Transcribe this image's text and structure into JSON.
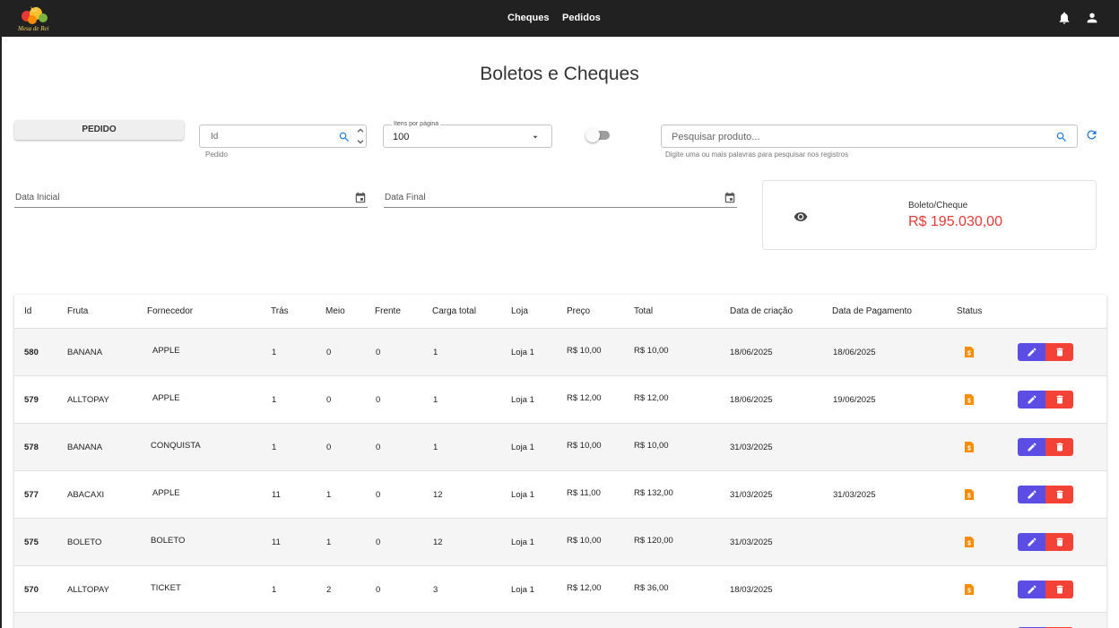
{
  "header": {
    "logo_text": "Mesa de Rei",
    "nav": [
      "Cheques",
      "Pedidos"
    ]
  },
  "page": {
    "title": "Boletos e Cheques"
  },
  "filters": {
    "pedido_button": "PEDIDO",
    "id_placeholder": "Id",
    "id_helper": "Pedido",
    "items_label": "Itens por página",
    "items_value": "100",
    "search_placeholder": "Pesquisar produto...",
    "search_helper": "Digite uma ou mais palavras para pesquisar nos registros",
    "date_start": "Data Inicial",
    "date_end": "Data Final"
  },
  "summary": {
    "label": "Boleto/Cheque",
    "value": "R$ 195.030,00"
  },
  "table": {
    "headers": [
      "Id",
      "Fruta",
      "Fornecedor",
      "Trás",
      "Meio",
      "Frente",
      "Carga total",
      "Loja",
      "Preço",
      "Total",
      "Data de criação",
      "Data de Pagamento",
      "Status"
    ],
    "rows": [
      {
        "id": "580",
        "fruta": "BANANA",
        "fornecedor": "APPLE",
        "tras": "1",
        "meio": "0",
        "frente": "0",
        "carga": "1",
        "loja": "Loja 1",
        "preco": "R$ 10,00",
        "total": "R$ 10,00",
        "criacao": "18/06/2025",
        "pagamento": "18/06/2025"
      },
      {
        "id": "579",
        "fruta": "ALLTOPAY",
        "fornecedor": "APPLE",
        "tras": "1",
        "meio": "0",
        "frente": "0",
        "carga": "1",
        "loja": "Loja 1",
        "preco": "R$ 12,00",
        "total": "R$ 12,00",
        "criacao": "18/06/2025",
        "pagamento": "19/06/2025"
      },
      {
        "id": "578",
        "fruta": "BANANA",
        "fornecedor": "CONQUISTA",
        "tras": "1",
        "meio": "0",
        "frente": "0",
        "carga": "1",
        "loja": "Loja 1",
        "preco": "R$ 10,00",
        "total": "R$ 10,00",
        "criacao": "31/03/2025",
        "pagamento": ""
      },
      {
        "id": "577",
        "fruta": "ABACAXI",
        "fornecedor": "APPLE",
        "tras": "11",
        "meio": "1",
        "frente": "0",
        "carga": "12",
        "loja": "Loja 1",
        "preco": "R$ 11,00",
        "total": "R$ 132,00",
        "criacao": "31/03/2025",
        "pagamento": "31/03/2025"
      },
      {
        "id": "575",
        "fruta": "BOLETO",
        "fornecedor": "BOLETO",
        "tras": "11",
        "meio": "1",
        "frente": "0",
        "carga": "12",
        "loja": "Loja 1",
        "preco": "R$ 10,00",
        "total": "R$ 120,00",
        "criacao": "31/03/2025",
        "pagamento": ""
      },
      {
        "id": "570",
        "fruta": "ALLTOPAY",
        "fornecedor": "TICKET",
        "tras": "1",
        "meio": "2",
        "frente": "0",
        "carga": "3",
        "loja": "Loja 1",
        "preco": "R$ 12,00",
        "total": "R$ 36,00",
        "criacao": "18/03/2025",
        "pagamento": ""
      }
    ]
  },
  "colors": {
    "accent": "#1976d2",
    "edit": "#5c4ee5",
    "delete": "#f44336",
    "status": "#fb8c00",
    "value": "#e53935"
  }
}
